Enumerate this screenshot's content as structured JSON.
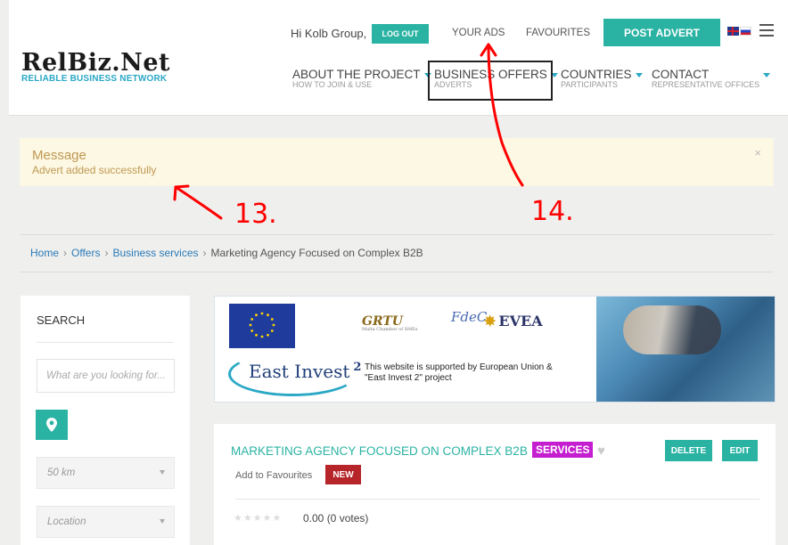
{
  "header": {
    "logo": {
      "main": "RelBiz.Net",
      "sub": "RELIABLE BUSINESS NETWORK"
    },
    "greeting": "Hi Kolb Group,",
    "logout_label": "LOG OUT",
    "your_ads_label": "YOUR ADS",
    "favourites_label": "FAVOURITES",
    "post_advert_label": "POST ADVERT",
    "nav": [
      {
        "label": "ABOUT THE PROJECT",
        "sub": "HOW TO JOIN & USE"
      },
      {
        "label": "BUSINESS OFFERS",
        "sub": "ADVERTS"
      },
      {
        "label": "COUNTRIES",
        "sub": "PARTICIPANTS"
      },
      {
        "label": "CONTACT",
        "sub": "REPRESENTATIVE OFFICES"
      }
    ]
  },
  "message": {
    "title": "Message",
    "text": "Advert added successfully",
    "close": "×"
  },
  "annotations": {
    "a13": "13.",
    "a14": "14."
  },
  "breadcrumb": {
    "home": "Home",
    "offers": "Offers",
    "business_services": "Business services",
    "current": "Marketing Agency Focused on Complex B2B",
    "sep": "›"
  },
  "sidebar": {
    "title": "SEARCH",
    "search_placeholder": "What are you looking for...?",
    "distance": "50 km",
    "location": "Location"
  },
  "banner": {
    "grtu": "GRTU",
    "grtu_sub": "Malta Chamber of SMEs",
    "fcdes": "FdeC",
    "evea": "EVEA",
    "east_invest": "East Invest",
    "east_invest_num": "2",
    "desc_line1": "This website is supported by European Union &",
    "desc_line2": "\"East Invest 2\" project"
  },
  "listing": {
    "title": "MARKETING AGENCY FOCUSED ON COMPLEX B2B",
    "category": "SERVICES",
    "delete_label": "DELETE",
    "edit_label": "EDIT",
    "add_fav_label": "Add to Favourites",
    "new_badge": "NEW",
    "stars": "★★★★★",
    "votes": "0.00 (0 votes)"
  },
  "colors": {
    "accent": "#2ab3a3",
    "link": "#2a7ab8",
    "services": "#c41ed0",
    "new": "#b5252a",
    "annotation": "#ff0000"
  }
}
